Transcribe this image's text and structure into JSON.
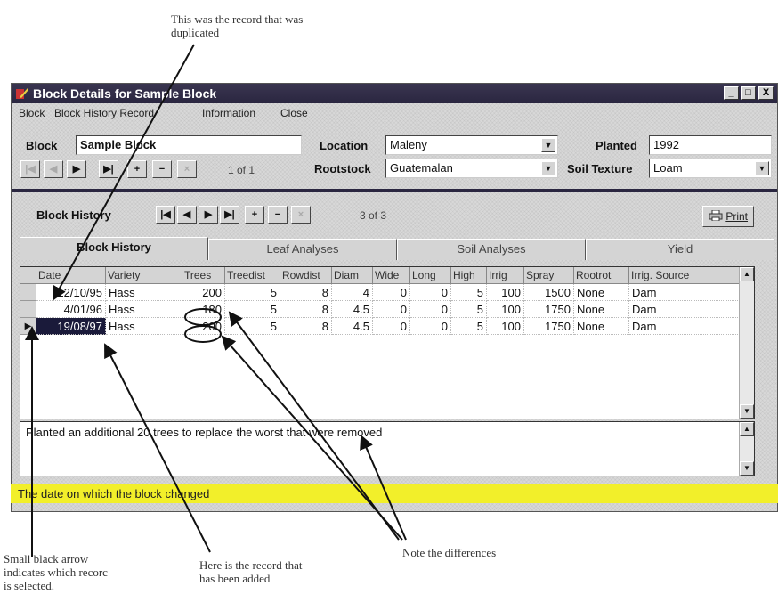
{
  "annotations": {
    "top_line1": "This was the record that was",
    "top_line2": "duplicated",
    "bottom_left_line1": "Small black arrow",
    "bottom_left_line2": "indicates which recorc",
    "bottom_left_line3": "is selected.",
    "bottom_mid_line1": "Here is the record that",
    "bottom_mid_line2": "has been added",
    "bottom_right": "Note the differences"
  },
  "window": {
    "title": "Block Details for Sample Block",
    "controls": {
      "minimize": "_",
      "maximize": "□",
      "close": "X"
    }
  },
  "menu": [
    "Block",
    "Block History Record",
    "Information",
    "Close"
  ],
  "block_panel": {
    "block_label": "Block",
    "block_value": "Sample Block",
    "location_label": "Location",
    "location_value": "Maleny",
    "planted_label": "Planted",
    "planted_value": "1992",
    "rootstock_label": "Rootstock",
    "rootstock_value": "Guatemalan",
    "soil_label": "Soil Texture",
    "soil_value": "Loam",
    "counter": "1 of 1"
  },
  "history_panel": {
    "label": "Block History",
    "counter": "3 of 3",
    "print_label": "Print"
  },
  "tabs": [
    "Block History",
    "Leaf Analyses",
    "Soil Analyses",
    "Yield"
  ],
  "grid": {
    "columns": [
      "Date",
      "Variety",
      "Trees",
      "Treedist",
      "Rowdist",
      "Diam",
      "Wide",
      "Long",
      "High",
      "Irrig",
      "Spray",
      "Rootrot",
      "Irrig. Source"
    ],
    "rows": [
      [
        "12/10/95",
        "Hass",
        "200",
        "5",
        "8",
        "4",
        "0",
        "0",
        "5",
        "100",
        "1500",
        "None",
        "Dam"
      ],
      [
        "4/01/96",
        "Hass",
        "180",
        "5",
        "8",
        "4.5",
        "0",
        "0",
        "5",
        "100",
        "1750",
        "None",
        "Dam"
      ],
      [
        "19/08/97",
        "Hass",
        "200",
        "5",
        "8",
        "4.5",
        "0",
        "0",
        "5",
        "100",
        "1750",
        "None",
        "Dam"
      ]
    ],
    "selected_row": 2
  },
  "memo": "Planted an additional 20 trees to replace the worst that were removed",
  "status": "The date on which the block changed"
}
